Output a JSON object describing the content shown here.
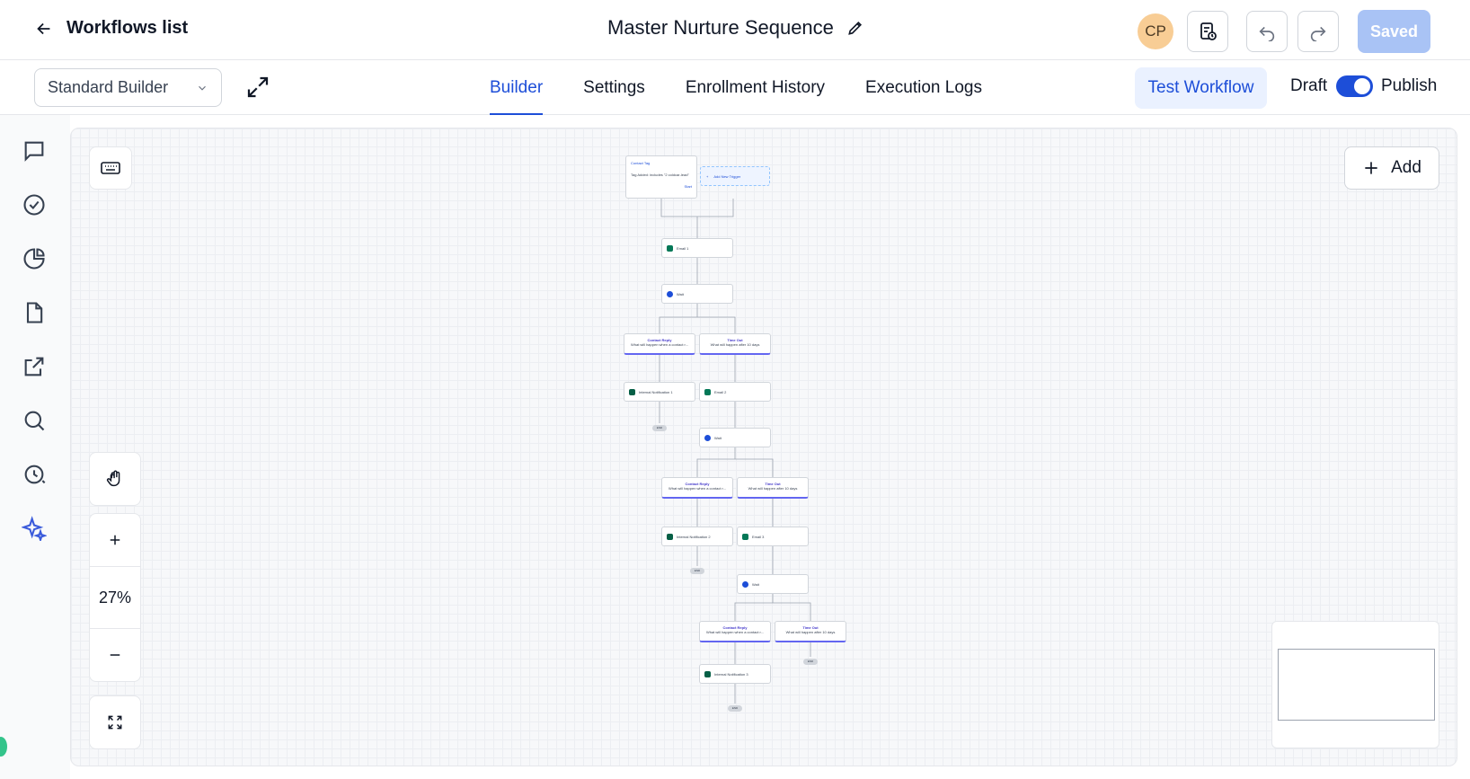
{
  "header": {
    "back_label": "Workflows list",
    "title": "Master Nurture Sequence",
    "avatar_initials": "CP",
    "saved_label": "Saved"
  },
  "subbar": {
    "builder_select": "Standard Builder",
    "tabs": [
      {
        "label": "Builder",
        "active": true
      },
      {
        "label": "Settings",
        "active": false
      },
      {
        "label": "Enrollment History",
        "active": false
      },
      {
        "label": "Execution Logs",
        "active": false
      }
    ],
    "test_label": "Test Workflow",
    "draft_label": "Draft",
    "publish_label": "Publish",
    "publish_on": true
  },
  "sidebar": {
    "icons": [
      "conversations-icon",
      "tasks-icon",
      "reports-icon",
      "documents-icon",
      "external-link-icon",
      "search-icon",
      "history-icon",
      "ai-sparkle-icon"
    ]
  },
  "canvas": {
    "add_label": "Add",
    "zoom": "27%",
    "trigger": {
      "title": "Contact Tag",
      "subtitle": "Tag Added: includes \"2 coldcar-lead\"",
      "start": "Start"
    },
    "add_trigger": "Add New Trigger",
    "nodes": {
      "email1": "Email 1",
      "wait1": "Wait",
      "internal1": "Internal Notification 1",
      "email2": "Email 2",
      "wait2": "Wait",
      "internal2": "Internal Notification 2",
      "email3": "Email 3",
      "wait3": "Wait",
      "internal3": "Internal Notification 3"
    },
    "branches": {
      "reply_title": "Contact Reply",
      "reply_sub": "What will happen when a contact r...",
      "timeout_title": "Time Out",
      "timeout_sub": "What will happen after 10 days"
    },
    "exit": "END"
  },
  "colors": {
    "accent": "#1d4ed8",
    "saved_bg": "#a9c3f5",
    "avatar_bg": "#f8cd95"
  }
}
